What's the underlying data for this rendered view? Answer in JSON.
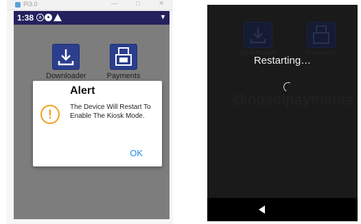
{
  "left_screen": {
    "window": {
      "title": "Pi3.0",
      "controls": [
        "—",
        "□",
        "✕"
      ]
    },
    "status_bar": {
      "time": "1:38",
      "icons": [
        "notification-icon",
        "app-icon",
        "warning-icon",
        "wifi-icon"
      ],
      "bg": "#24215e"
    },
    "apps": [
      {
        "label": "Downloader",
        "icon": "download-icon"
      },
      {
        "label": "Payments",
        "icon": "payments-icon"
      }
    ],
    "dialog": {
      "title": "Alert",
      "message": "The Device Will Restart To Enable The Kiosk Mode.",
      "ok_label": "OK",
      "icon": "warning-icon",
      "icon_color": "#f2a11d",
      "ok_color": "#1e88e5"
    }
  },
  "right_screen": {
    "background_apps": [
      {
        "label": "Downloader",
        "icon": "download-icon"
      },
      {
        "label": "Payments",
        "icon": "payments-icon"
      }
    ],
    "background_handle": "@obsolpayments",
    "status_text": "Restarting…",
    "nav": {
      "back_icon": "back-triangle-icon"
    }
  }
}
